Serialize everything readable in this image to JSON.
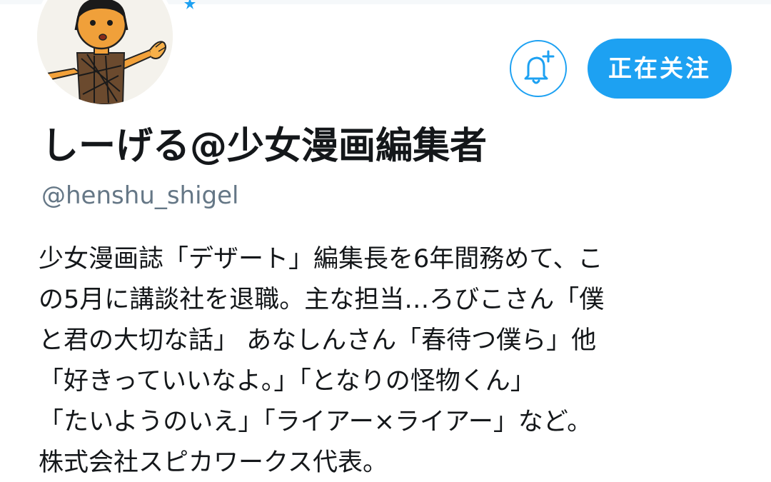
{
  "profile": {
    "display_name": "しーげる@少女漫画編集者",
    "handle": "@henshu_shigel",
    "bio_lines": [
      "少女漫画誌「デザート」編集長を6年間務めて、こ",
      "の5月に講談社を退職。主な担当…ろびこさん「僕",
      "と君の大切な話」 あなしんさん「春待つ僕ら」他",
      "「好きっていいなよ。」「となりの怪物くん」",
      "「たいようのいえ」「ライアー×ライアー」など。",
      "株式会社スピカワークス代表。"
    ]
  },
  "actions": {
    "follow_label": "正在关注",
    "notifications_icon": "bell-plus-icon"
  },
  "colors": {
    "accent": "#1da1f2",
    "text_primary": "#14171a",
    "text_secondary": "#657786",
    "background": "#ffffff"
  }
}
